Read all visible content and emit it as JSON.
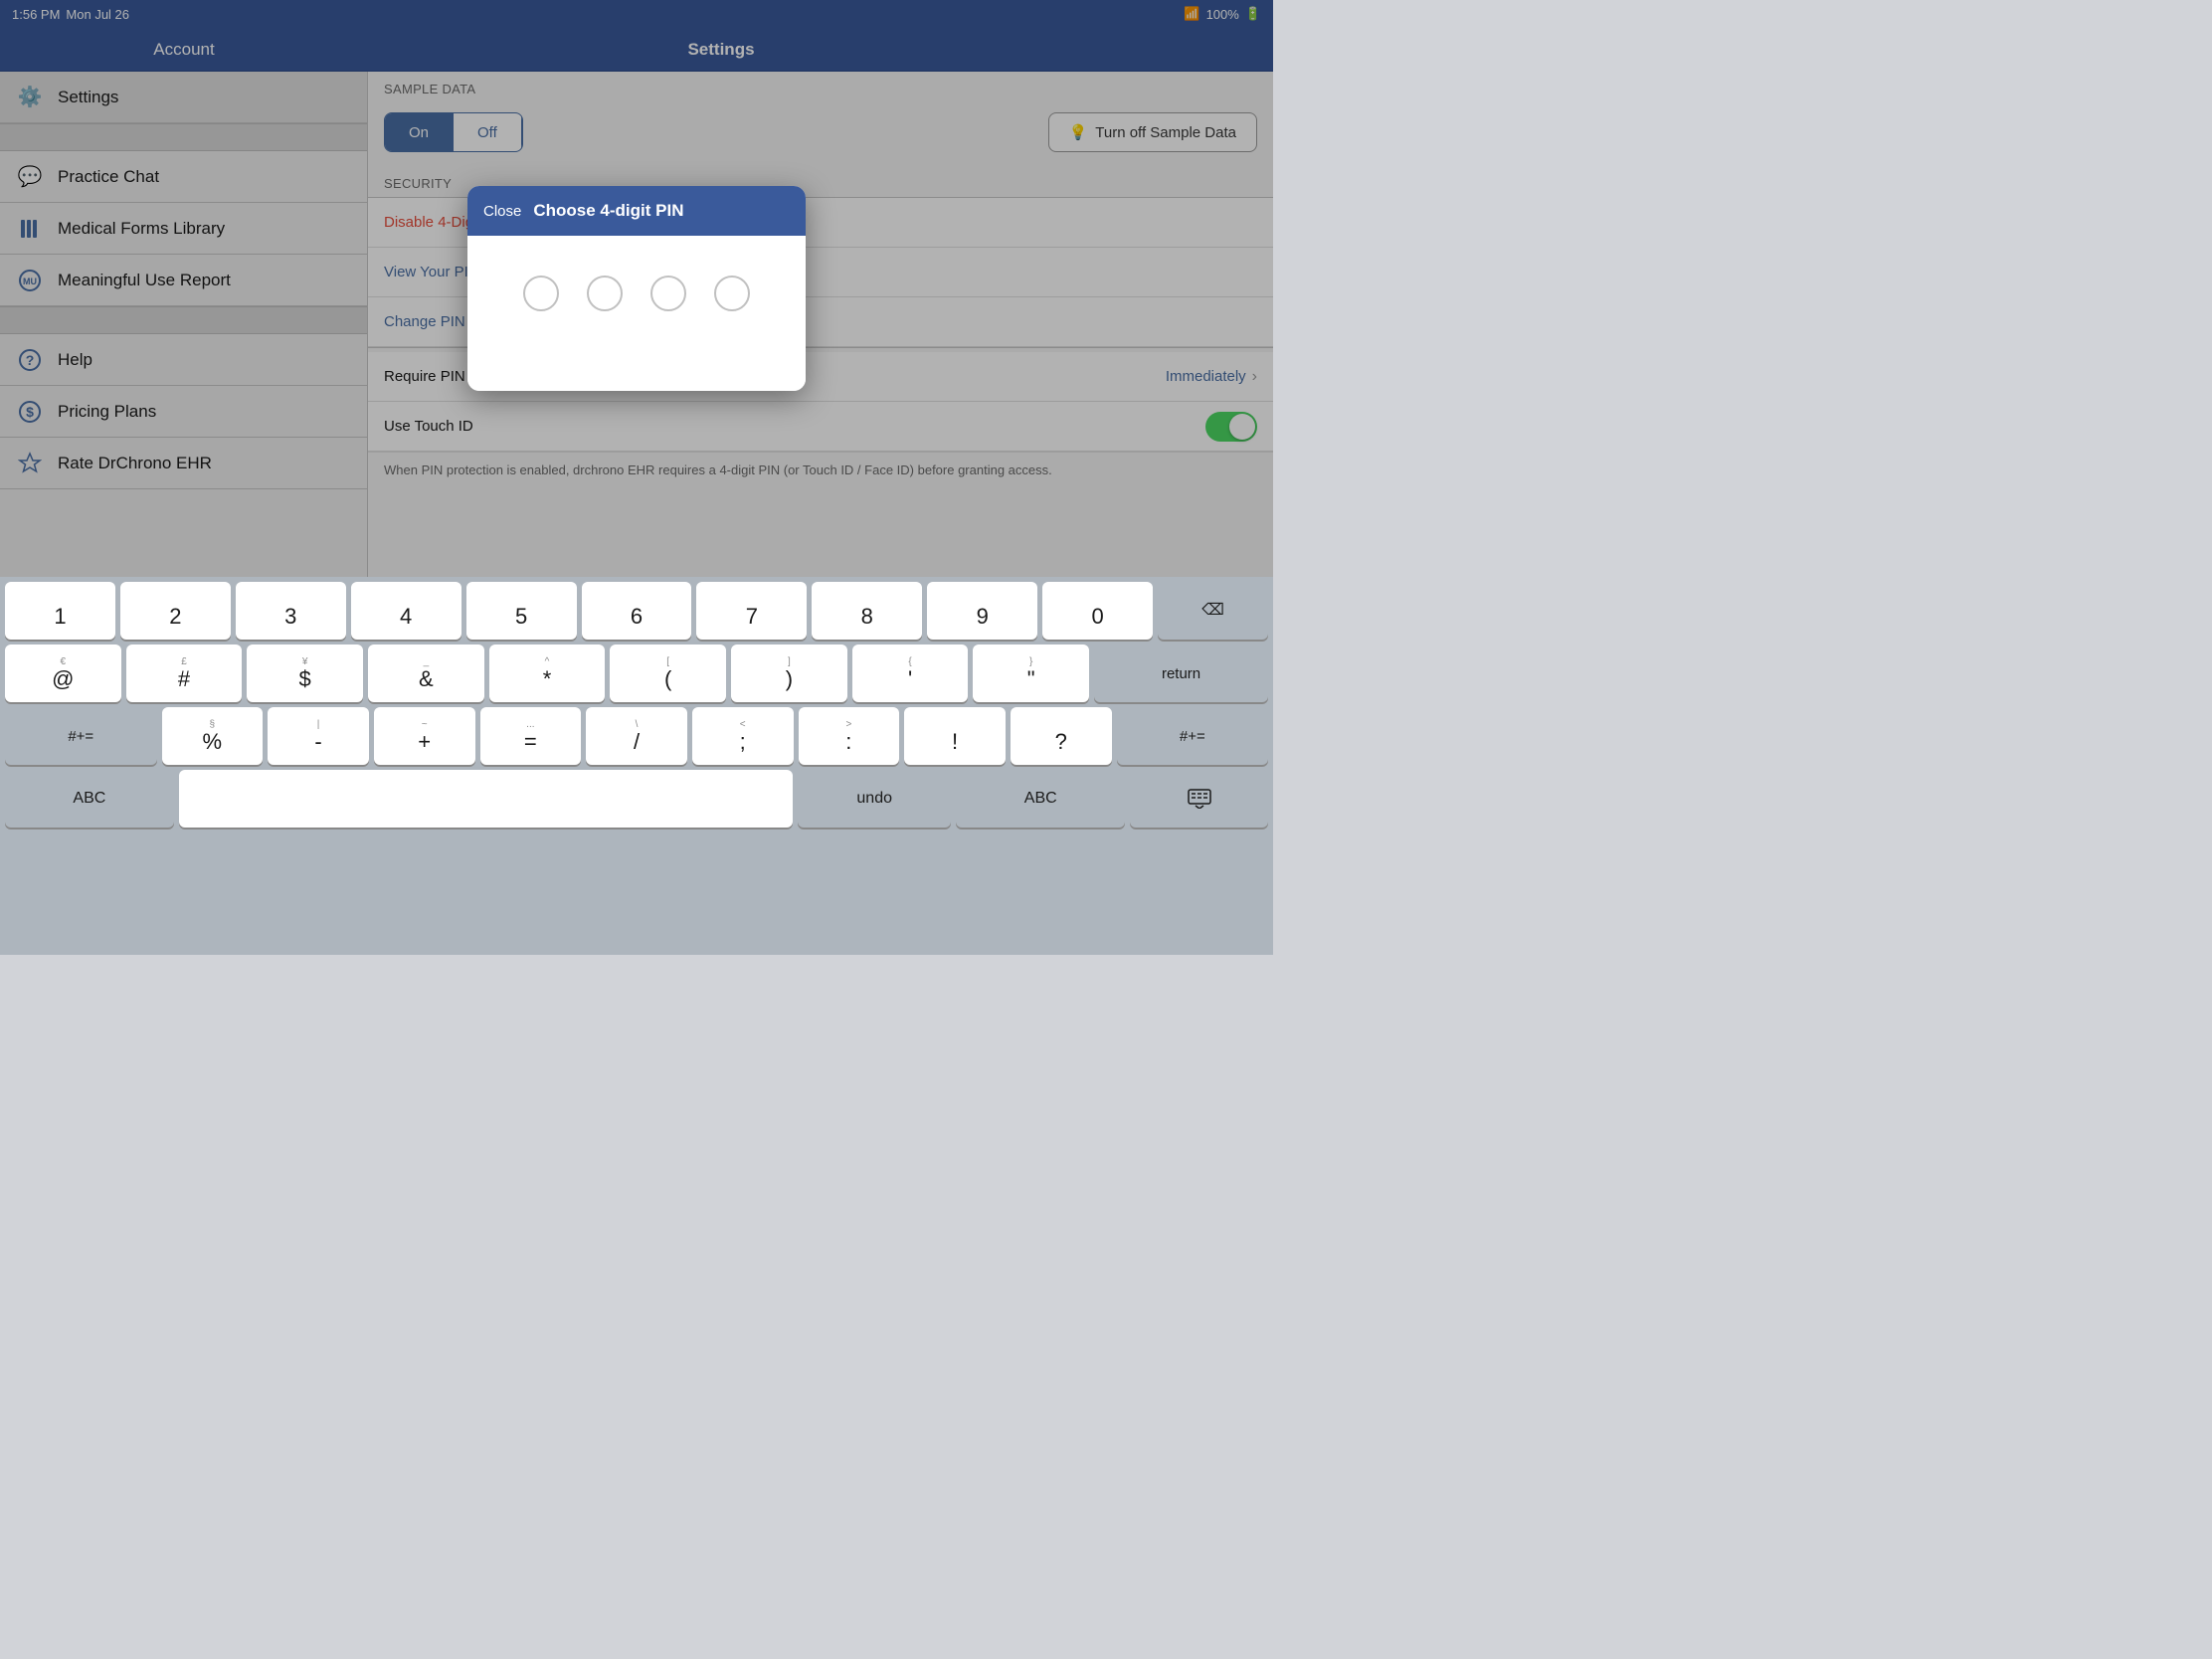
{
  "status_bar": {
    "time": "1:56 PM",
    "day": "Mon Jul 26",
    "wifi": "WiFi",
    "battery": "100%"
  },
  "nav": {
    "left_title": "Account",
    "center_title": "Settings"
  },
  "sidebar": {
    "items": [
      {
        "id": "settings",
        "label": "Settings",
        "icon": "⚙",
        "active": true
      },
      {
        "id": "practice-chat",
        "label": "Practice Chat",
        "icon": "💬"
      },
      {
        "id": "medical-forms",
        "label": "Medical Forms Library",
        "icon": "📋"
      },
      {
        "id": "meaningful-use",
        "label": "Meaningful Use Report",
        "icon": "🔵"
      },
      {
        "id": "help",
        "label": "Help",
        "icon": "❓"
      },
      {
        "id": "pricing",
        "label": "Pricing Plans",
        "icon": "💲"
      },
      {
        "id": "rate",
        "label": "Rate DrChrono EHR",
        "icon": "⭐"
      }
    ]
  },
  "content": {
    "sample_data_section_label": "SAMPLE DATA",
    "security_section_label": "SECURITY",
    "toggle_options": [
      "On",
      "Off"
    ],
    "turn_off_button": "Turn off Sample Data",
    "security_rows": [
      {
        "label": "Disable 4-Digit PIN",
        "color": "red"
      },
      {
        "label": "View Your PIN",
        "color": "blue"
      },
      {
        "label": "Change PIN",
        "color": "blue"
      }
    ],
    "require_pin_label": "Require PIN Code",
    "require_pin_value": "Immediately",
    "use_touch_id_label": "Use Touch ID",
    "settings_note": "When PIN protection is enabled, drchrono EHR requires a 4-digit PIN (or Touch ID / Face ID) before granting access."
  },
  "modal": {
    "close_label": "Close",
    "title": "Choose 4-digit PIN",
    "pin_dots": 4
  },
  "keyboard": {
    "row1": [
      "1",
      "2",
      "3",
      "4",
      "5",
      "6",
      "7",
      "8",
      "9",
      "0"
    ],
    "row1_sub": [
      "",
      "",
      "",
      "",
      "",
      "",
      "",
      "",
      "",
      ""
    ],
    "row2": [
      "@",
      "#",
      "$",
      "&",
      "*",
      "(",
      ")",
      "'",
      "\""
    ],
    "row2_sub": [
      "€",
      "£",
      "¥",
      "_",
      "^",
      "[",
      "]",
      "{",
      "}"
    ],
    "row3": [
      "%",
      "-",
      "+",
      "=",
      "/",
      ";",
      ":",
      "!",
      "?"
    ],
    "row3_sub": [
      "§",
      "|",
      "~",
      "...",
      "\\",
      "<",
      ">",
      "",
      ""
    ],
    "symbols_label": "#+=",
    "return_label": "return",
    "abc_label": "ABC",
    "undo_label": "undo",
    "symbols2_label": "#+=",
    "delete_label": "⌫"
  }
}
